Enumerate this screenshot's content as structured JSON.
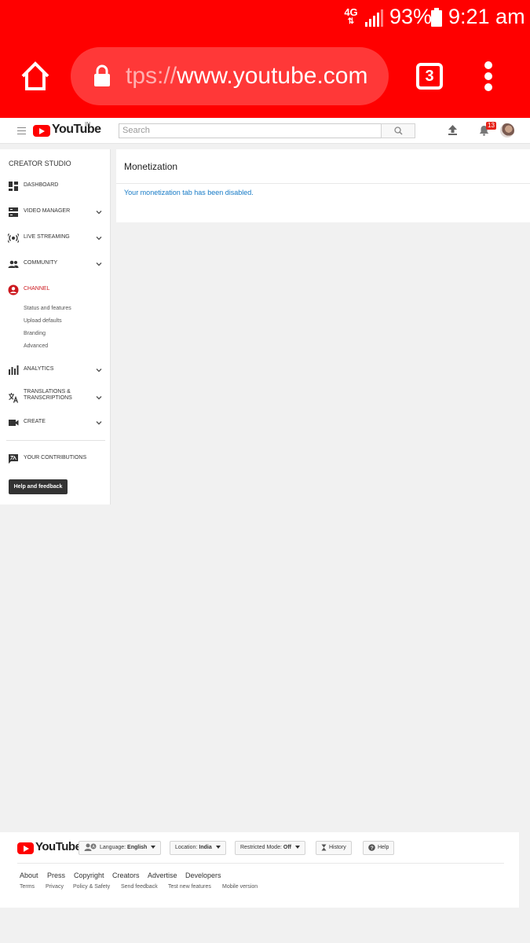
{
  "status_bar": {
    "network": "4G",
    "battery_percent": "93%",
    "time": "9:21 am"
  },
  "browser": {
    "url_prefix": "tps://",
    "url_host": "www.youtube.com",
    "tab_count": "3"
  },
  "header": {
    "search_placeholder": "Search",
    "region": "IN",
    "logo_text": "YouTube",
    "notification_count": "13"
  },
  "sidebar": {
    "title": "CREATOR STUDIO",
    "items": [
      {
        "label": "DASHBOARD"
      },
      {
        "label": "VIDEO MANAGER"
      },
      {
        "label": "LIVE STREAMING"
      },
      {
        "label": "COMMUNITY"
      },
      {
        "label": "CHANNEL"
      },
      {
        "label": "ANALYTICS"
      },
      {
        "label": "TRANSLATIONS & TRANSCRIPTIONS"
      },
      {
        "label": "CREATE"
      },
      {
        "label": "YOUR CONTRIBUTIONS"
      }
    ],
    "channel_subitems": [
      "Status and features",
      "Upload defaults",
      "Branding",
      "Advanced"
    ],
    "help_button": "Help and feedback",
    "active_color": "#cc181e"
  },
  "main": {
    "title": "Monetization",
    "message": "Your monetization tab has been disabled."
  },
  "footer": {
    "logo_text": "YouTube",
    "language_label": "Language:",
    "language_value": "English",
    "location_label": "Location:",
    "location_value": "India",
    "restricted_label": "Restricted Mode:",
    "restricted_value": "Off",
    "history": "History",
    "help": "Help",
    "links": [
      "About",
      "Press",
      "Copyright",
      "Creators",
      "Advertise",
      "Developers"
    ],
    "sublinks": [
      "Terms",
      "Privacy",
      "Policy & Safety",
      "Send feedback",
      "Test new features",
      "Mobile version"
    ]
  },
  "colors": {
    "brand": "#ff0000",
    "link": "#167ac6"
  }
}
